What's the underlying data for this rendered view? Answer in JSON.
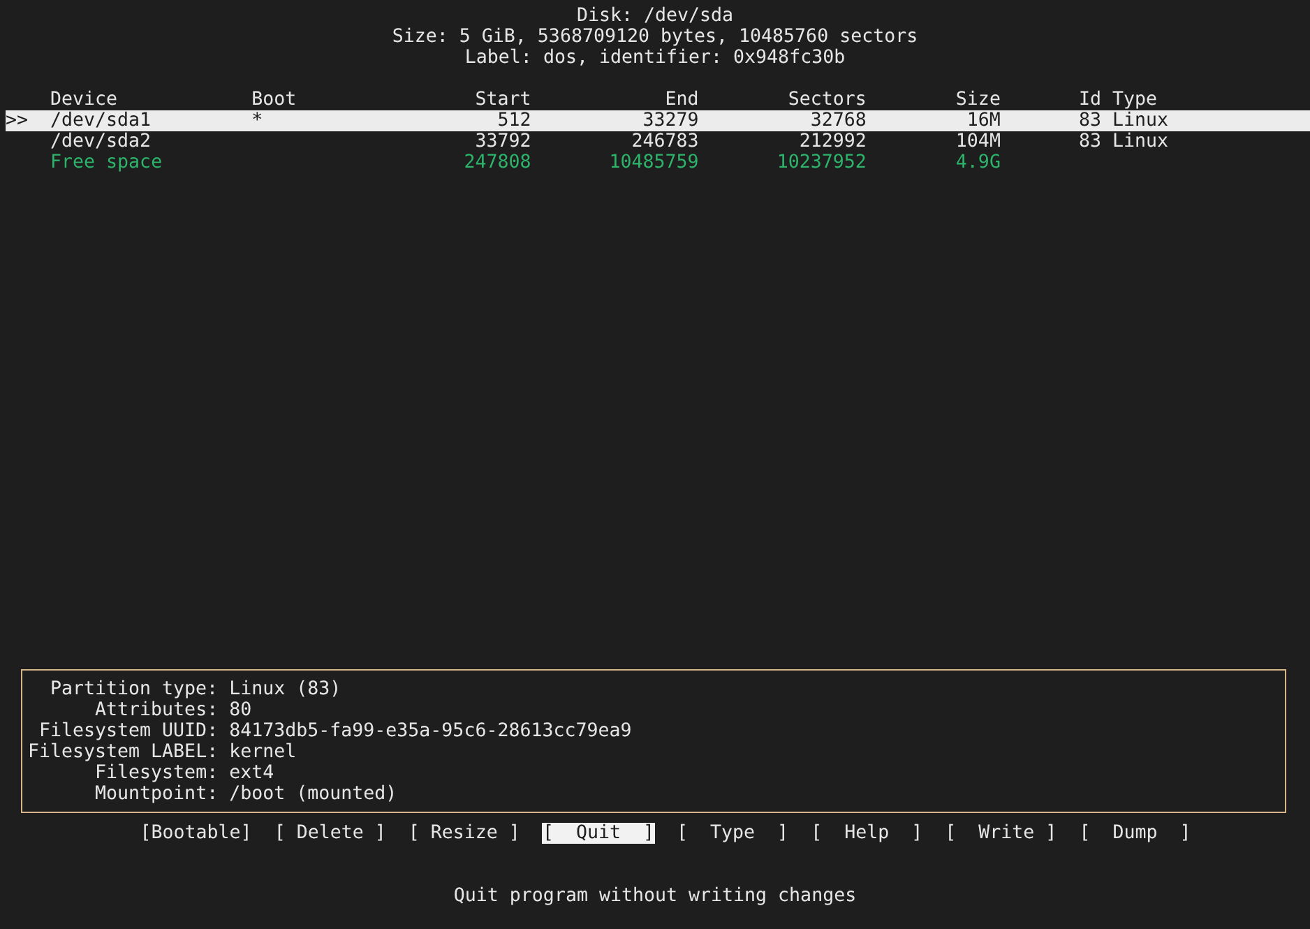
{
  "header": {
    "disk": "Disk: /dev/sda",
    "size": "Size: 5 GiB, 5368709120 bytes, 10485760 sectors",
    "label": "Label: dos, identifier: 0x948fc30b"
  },
  "table": {
    "cursor": ">>",
    "columns": [
      "Device",
      "Boot",
      "Start",
      "End",
      "Sectors",
      "Size",
      "Id",
      "Type"
    ],
    "rows": [
      {
        "kind": "partition",
        "selected": true,
        "cells": [
          "/dev/sda1",
          "*",
          "512",
          "33279",
          "32768",
          "16M",
          "83",
          "Linux"
        ]
      },
      {
        "kind": "partition",
        "selected": false,
        "cells": [
          "/dev/sda2",
          "",
          "33792",
          "246783",
          "212992",
          "104M",
          "83",
          "Linux"
        ]
      },
      {
        "kind": "free",
        "selected": false,
        "cells": [
          "Free space",
          "",
          "247808",
          "10485759",
          "10237952",
          "4.9G",
          "",
          ""
        ]
      }
    ]
  },
  "info": [
    {
      "label": "Partition type:",
      "value": "Linux (83)"
    },
    {
      "label": "Attributes:",
      "value": "80"
    },
    {
      "label": "Filesystem UUID:",
      "value": "84173db5-fa99-e35a-95c6-28613cc79ea9"
    },
    {
      "label": "Filesystem LABEL:",
      "value": "kernel"
    },
    {
      "label": "Filesystem:",
      "value": "ext4"
    },
    {
      "label": "Mountpoint:",
      "value": "/boot (mounted)"
    }
  ],
  "buttons": [
    {
      "label": "[Bootable]",
      "selected": false
    },
    {
      "label": "[ Delete ]",
      "selected": false
    },
    {
      "label": "[ Resize ]",
      "selected": false
    },
    {
      "label": "[  Quit  ]",
      "selected": true
    },
    {
      "label": "[  Type  ]",
      "selected": false
    },
    {
      "label": "[  Help  ]",
      "selected": false
    },
    {
      "label": "[  Write ]",
      "selected": false
    },
    {
      "label": "[  Dump  ]",
      "selected": false
    }
  ],
  "status": "Quit program without writing changes"
}
